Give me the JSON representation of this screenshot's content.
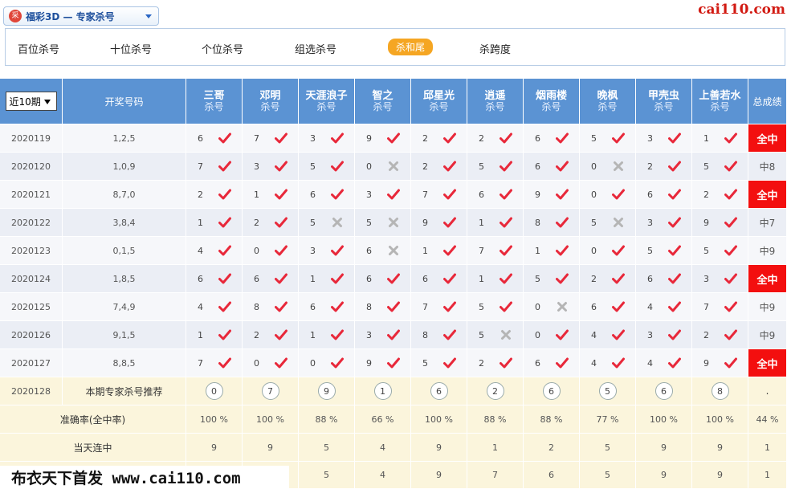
{
  "header": {
    "logo_text": "采",
    "selector_title": "福彩3D — 专家杀号",
    "site_logo": "cai110.com"
  },
  "tabs": [
    {
      "label": "百位杀号",
      "active": false
    },
    {
      "label": "十位杀号",
      "active": false
    },
    {
      "label": "个位杀号",
      "active": false
    },
    {
      "label": "组选杀号",
      "active": false
    },
    {
      "label": "杀和尾",
      "active": true
    },
    {
      "label": "杀跨度",
      "active": false
    }
  ],
  "table": {
    "period_select": "近10期",
    "draw_col_header": "开奖号码",
    "total_col_header": "总成绩",
    "experts": [
      {
        "name": "三哥",
        "sub": "杀号"
      },
      {
        "name": "邓明",
        "sub": "杀号"
      },
      {
        "name": "天涯浪子",
        "sub": "杀号"
      },
      {
        "name": "智之",
        "sub": "杀号"
      },
      {
        "name": "邱星光",
        "sub": "杀号"
      },
      {
        "name": "逍遥",
        "sub": "杀号"
      },
      {
        "name": "烟雨楼",
        "sub": "杀号"
      },
      {
        "name": "晚枫",
        "sub": "杀号"
      },
      {
        "name": "甲壳虫",
        "sub": "杀号"
      },
      {
        "name": "上善若水",
        "sub": "杀号"
      }
    ],
    "rows": [
      {
        "period": "2020119",
        "draw": "1,2,5",
        "picks": [
          [
            "6",
            true
          ],
          [
            "7",
            true
          ],
          [
            "3",
            true
          ],
          [
            "9",
            true
          ],
          [
            "2",
            true
          ],
          [
            "2",
            true
          ],
          [
            "6",
            true
          ],
          [
            "5",
            true
          ],
          [
            "3",
            true
          ],
          [
            "1",
            true
          ]
        ],
        "total": "全中",
        "hit": true
      },
      {
        "period": "2020120",
        "draw": "1,0,9",
        "picks": [
          [
            "7",
            true
          ],
          [
            "3",
            true
          ],
          [
            "5",
            true
          ],
          [
            "0",
            false
          ],
          [
            "2",
            true
          ],
          [
            "5",
            true
          ],
          [
            "6",
            true
          ],
          [
            "0",
            false
          ],
          [
            "2",
            true
          ],
          [
            "5",
            true
          ]
        ],
        "total": "中8",
        "hit": false
      },
      {
        "period": "2020121",
        "draw": "8,7,0",
        "picks": [
          [
            "2",
            true
          ],
          [
            "1",
            true
          ],
          [
            "6",
            true
          ],
          [
            "3",
            true
          ],
          [
            "7",
            true
          ],
          [
            "6",
            true
          ],
          [
            "9",
            true
          ],
          [
            "0",
            true
          ],
          [
            "6",
            true
          ],
          [
            "2",
            true
          ]
        ],
        "total": "全中",
        "hit": true
      },
      {
        "period": "2020122",
        "draw": "3,8,4",
        "picks": [
          [
            "1",
            true
          ],
          [
            "2",
            true
          ],
          [
            "5",
            false
          ],
          [
            "5",
            false
          ],
          [
            "9",
            true
          ],
          [
            "1",
            true
          ],
          [
            "8",
            true
          ],
          [
            "5",
            false
          ],
          [
            "3",
            true
          ],
          [
            "9",
            true
          ]
        ],
        "total": "中7",
        "hit": false
      },
      {
        "period": "2020123",
        "draw": "0,1,5",
        "picks": [
          [
            "4",
            true
          ],
          [
            "0",
            true
          ],
          [
            "3",
            true
          ],
          [
            "6",
            false
          ],
          [
            "1",
            true
          ],
          [
            "7",
            true
          ],
          [
            "1",
            true
          ],
          [
            "0",
            true
          ],
          [
            "5",
            true
          ],
          [
            "5",
            true
          ]
        ],
        "total": "中9",
        "hit": false
      },
      {
        "period": "2020124",
        "draw": "1,8,5",
        "picks": [
          [
            "6",
            true
          ],
          [
            "6",
            true
          ],
          [
            "1",
            true
          ],
          [
            "6",
            true
          ],
          [
            "6",
            true
          ],
          [
            "1",
            true
          ],
          [
            "5",
            true
          ],
          [
            "2",
            true
          ],
          [
            "6",
            true
          ],
          [
            "3",
            true
          ]
        ],
        "total": "全中",
        "hit": true
      },
      {
        "period": "2020125",
        "draw": "7,4,9",
        "picks": [
          [
            "4",
            true
          ],
          [
            "8",
            true
          ],
          [
            "6",
            true
          ],
          [
            "8",
            true
          ],
          [
            "7",
            true
          ],
          [
            "5",
            true
          ],
          [
            "0",
            false
          ],
          [
            "6",
            true
          ],
          [
            "4",
            true
          ],
          [
            "7",
            true
          ]
        ],
        "total": "中9",
        "hit": false
      },
      {
        "period": "2020126",
        "draw": "9,1,5",
        "picks": [
          [
            "1",
            true
          ],
          [
            "2",
            true
          ],
          [
            "1",
            true
          ],
          [
            "3",
            true
          ],
          [
            "8",
            true
          ],
          [
            "5",
            false
          ],
          [
            "0",
            true
          ],
          [
            "4",
            true
          ],
          [
            "3",
            true
          ],
          [
            "2",
            true
          ]
        ],
        "total": "中9",
        "hit": false
      },
      {
        "period": "2020127",
        "draw": "8,8,5",
        "picks": [
          [
            "7",
            true
          ],
          [
            "0",
            true
          ],
          [
            "0",
            true
          ],
          [
            "9",
            true
          ],
          [
            "5",
            true
          ],
          [
            "2",
            true
          ],
          [
            "6",
            true
          ],
          [
            "4",
            true
          ],
          [
            "4",
            true
          ],
          [
            "9",
            true
          ]
        ],
        "total": "全中",
        "hit": true
      }
    ],
    "recommend": {
      "period": "2020128",
      "label": "本期专家杀号推荐",
      "values": [
        "0",
        "7",
        "9",
        "1",
        "6",
        "2",
        "6",
        "5",
        "6",
        "8"
      ],
      "total": "."
    },
    "accuracy": {
      "label": "准确率(全中率)",
      "values": [
        "100 %",
        "100 %",
        "88 %",
        "66 %",
        "100 %",
        "88 %",
        "88 %",
        "77 %",
        "100 %",
        "100 %"
      ],
      "total": "44 %"
    },
    "streak": {
      "label": "当天连中",
      "values": [
        "9",
        "9",
        "5",
        "4",
        "9",
        "1",
        "2",
        "5",
        "9",
        "9"
      ],
      "total": "1"
    },
    "last_row": {
      "values": [
        "",
        "",
        "5",
        "4",
        "9",
        "7",
        "6",
        "5",
        "9",
        "9"
      ],
      "total": "1"
    }
  },
  "watermark": "布衣天下首发 www.cai110.com",
  "colors": {
    "header_blue": "#5b93d3",
    "hit_red": "#f30f0f",
    "check_red": "#e8283a",
    "cross_gray": "#b5b5b5",
    "tab_active": "#f5a623"
  }
}
